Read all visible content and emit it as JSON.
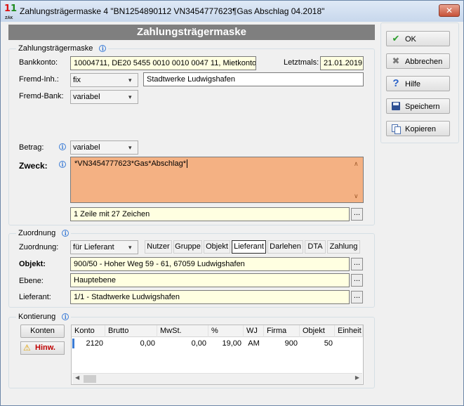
{
  "window": {
    "title": "Zahlungsträgermaske 4 \"BN1254890112 VN3454777623¶Gas Abschlag 04.2018\"",
    "close_glyph": "✕"
  },
  "header": {
    "title": "Zahlungsträgermaske"
  },
  "sections": {
    "payer": "Zahlungsträgermaske",
    "assignment": "Zuordnung",
    "accounting": "Kontierung"
  },
  "form": {
    "bankkonto": {
      "label": "Bankkonto:",
      "value": "10004711,  DE20 5455 0010 0010 0047 11,  Mietkonto"
    },
    "letztmals": {
      "label": "Letztmals:",
      "value": "21.01.2019"
    },
    "fremd_inh": {
      "label": "Fremd-Inh.:",
      "selected": "fix",
      "value": "Stadtwerke Ludwigshafen"
    },
    "fremd_bank": {
      "label": "Fremd-Bank:",
      "selected": "variabel"
    },
    "betrag": {
      "label": "Betrag:",
      "selected": "variabel"
    },
    "zweck": {
      "label": "Zweck:",
      "value": "*VN3454777623*Gas*Abschlag*",
      "info": "1 Zeile mit 27 Zeichen"
    }
  },
  "assignment": {
    "zuordnung": {
      "label": "Zuordnung:",
      "selected": "für Lieferant"
    },
    "tabs": [
      {
        "label": "Nutzer",
        "active": false
      },
      {
        "label": "Gruppe",
        "active": false
      },
      {
        "label": "Objekt",
        "active": false
      },
      {
        "label": "Lieferant",
        "active": true
      },
      {
        "label": "Darlehen",
        "active": false
      },
      {
        "label": "DTA",
        "active": false
      },
      {
        "label": "Zahlung",
        "active": false
      }
    ],
    "objekt": {
      "label": "Objekt:",
      "value": "900/50 - Hoher Weg 59 - 61, 67059 Ludwigshafen"
    },
    "ebene": {
      "label": "Ebene:",
      "value": "Hauptebene"
    },
    "lieferant": {
      "label": "Lieferant:",
      "value": "1/1 - Stadtwerke Ludwigshafen"
    }
  },
  "accounting": {
    "konten_button": "Konten",
    "hinweis_button": "Hinw.",
    "columns": [
      "Konto",
      "Brutto",
      "MwSt.",
      "%",
      "WJ",
      "Firma",
      "Objekt",
      "Einheit"
    ],
    "rows": [
      [
        "2120",
        "0,00",
        "0,00",
        "19,00",
        "AM",
        "900",
        "50",
        ""
      ]
    ]
  },
  "actions": {
    "ok": "OK",
    "abbrechen": "Abbrechen",
    "hilfe": "Hilfe",
    "speichern": "Speichern",
    "kopieren": "Kopieren"
  },
  "glyphs": {
    "ellipsis": "...",
    "info": "i",
    "dropdown": "▾"
  },
  "colors": {
    "zweck_bg": "#f4b183",
    "field_bg": "#ffffe1",
    "header_bg": "#7f7f7f"
  }
}
